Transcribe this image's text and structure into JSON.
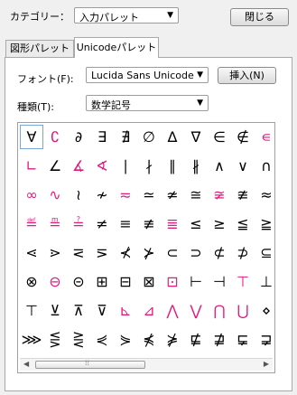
{
  "header": {
    "category_label": "カテゴリー：",
    "category_value": "入力パレット",
    "close_label": "閉じる"
  },
  "tabs": [
    {
      "label": "図形パレット",
      "active": false
    },
    {
      "label": "Unicodeパレット",
      "active": true
    }
  ],
  "font": {
    "label": "フォント(F):",
    "value": "Lucida Sans Unicode",
    "insert_label": "挿入(N)"
  },
  "kind": {
    "label": "種類(T):",
    "value": "数学記号"
  },
  "colors": {
    "accent": "#e0197d",
    "text": "#000000"
  },
  "grid": [
    [
      {
        "c": "∀",
        "p": false
      },
      {
        "c": "∁",
        "p": true
      },
      {
        "c": "∂",
        "p": false
      },
      {
        "c": "∃",
        "p": false
      },
      {
        "c": "∄",
        "p": false
      },
      {
        "c": "∅",
        "p": false
      },
      {
        "c": "∆",
        "p": false
      },
      {
        "c": "∇",
        "p": false
      },
      {
        "c": "∈",
        "p": false
      },
      {
        "c": "∉",
        "p": false
      },
      {
        "c": "∊",
        "p": true
      }
    ],
    [
      {
        "c": "∟",
        "p": true
      },
      {
        "c": "∠",
        "p": false
      },
      {
        "c": "∡",
        "p": true
      },
      {
        "c": "∢",
        "p": true
      },
      {
        "c": "∣",
        "p": false
      },
      {
        "c": "∤",
        "p": false
      },
      {
        "c": "∥",
        "p": false
      },
      {
        "c": "∦",
        "p": false
      },
      {
        "c": "∧",
        "p": false
      },
      {
        "c": "∨",
        "p": false
      },
      {
        "c": "∩",
        "p": false
      }
    ],
    [
      {
        "c": "∞",
        "p": true
      },
      {
        "c": "∿",
        "p": true
      },
      {
        "c": "≀",
        "p": false
      },
      {
        "c": "≁",
        "p": false
      },
      {
        "c": "≂",
        "p": true
      },
      {
        "c": "≃",
        "p": false
      },
      {
        "c": "≄",
        "p": false
      },
      {
        "c": "≅",
        "p": false
      },
      {
        "c": "≆",
        "p": true
      },
      {
        "c": "≇",
        "p": false
      },
      {
        "c": "≈",
        "p": false
      }
    ],
    [
      {
        "c": "≝",
        "p": true
      },
      {
        "c": "≞",
        "p": true
      },
      {
        "c": "≟",
        "p": true
      },
      {
        "c": "≠",
        "p": false
      },
      {
        "c": "≡",
        "p": false
      },
      {
        "c": "≢",
        "p": false
      },
      {
        "c": "≣",
        "p": true
      },
      {
        "c": "≤",
        "p": false
      },
      {
        "c": "≥",
        "p": false
      },
      {
        "c": "≦",
        "p": false
      },
      {
        "c": "≧",
        "p": false
      }
    ],
    [
      {
        "c": "⋖",
        "p": false
      },
      {
        "c": "⋗",
        "p": false
      },
      {
        "c": "⋜",
        "p": false
      },
      {
        "c": "⋝",
        "p": false
      },
      {
        "c": "⊀",
        "p": false
      },
      {
        "c": "⊁",
        "p": false
      },
      {
        "c": "⊂",
        "p": false
      },
      {
        "c": "⊃",
        "p": false
      },
      {
        "c": "⊄",
        "p": false
      },
      {
        "c": "⊅",
        "p": false
      },
      {
        "c": "⊆",
        "p": false
      }
    ],
    [
      {
        "c": "⊗",
        "p": false
      },
      {
        "c": "⊖",
        "p": true
      },
      {
        "c": "⊝",
        "p": false
      },
      {
        "c": "⊞",
        "p": false
      },
      {
        "c": "⊟",
        "p": false
      },
      {
        "c": "⊠",
        "p": false
      },
      {
        "c": "⊡",
        "p": true
      },
      {
        "c": "⊢",
        "p": false
      },
      {
        "c": "⊣",
        "p": false
      },
      {
        "c": "⊤",
        "p": true
      },
      {
        "c": "⊥",
        "p": false
      }
    ],
    [
      {
        "c": "⊤",
        "p": false
      },
      {
        "c": "⊻",
        "p": false
      },
      {
        "c": "⊼",
        "p": false
      },
      {
        "c": "⊽",
        "p": false
      },
      {
        "c": "⊾",
        "p": true
      },
      {
        "c": "⊿",
        "p": true
      },
      {
        "c": "⋀",
        "p": true
      },
      {
        "c": "⋁",
        "p": true
      },
      {
        "c": "⋂",
        "p": true
      },
      {
        "c": "⋃",
        "p": true
      },
      {
        "c": "⋄",
        "p": false
      }
    ],
    [
      {
        "c": "⋙",
        "p": false
      },
      {
        "c": "⋚",
        "p": false
      },
      {
        "c": "⋛",
        "p": false
      },
      {
        "c": "⋞",
        "p": false
      },
      {
        "c": "⋟",
        "p": false
      },
      {
        "c": "⋠",
        "p": false
      },
      {
        "c": "⋡",
        "p": false
      },
      {
        "c": "⋢",
        "p": false
      },
      {
        "c": "⋣",
        "p": false
      },
      {
        "c": "⋤",
        "p": false
      },
      {
        "c": "⋥",
        "p": false
      }
    ]
  ]
}
